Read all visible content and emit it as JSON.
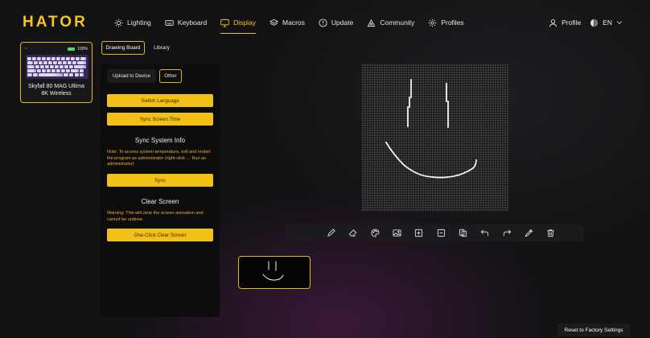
{
  "brand": "HATOR",
  "nav": {
    "items": [
      {
        "label": "Lighting",
        "icon": "sun-icon"
      },
      {
        "label": "Keyboard",
        "icon": "keyboard-icon"
      },
      {
        "label": "Display",
        "icon": "monitor-icon",
        "active": true
      },
      {
        "label": "Macros",
        "icon": "layers-icon"
      },
      {
        "label": "Update",
        "icon": "exclamation-circle-icon"
      },
      {
        "label": "Community",
        "icon": "community-icon"
      },
      {
        "label": "Profiles",
        "icon": "gear-icon"
      }
    ],
    "profile_label": "Profile",
    "language": "EN"
  },
  "device": {
    "name_line1": "Skyfall 80 MAG Ultima",
    "name_line2": "8K Wireless",
    "battery": "100%",
    "status_glyph": "~"
  },
  "subtabs": {
    "drawing_board": "Drawing Board",
    "library": "Library"
  },
  "panel": {
    "tab_upload": "Upload to Device",
    "tab_other": "Other",
    "switch_language": "Switch Language",
    "sync_screen_time": "Sync Screen Time",
    "sync_system_info_title": "Sync System Info",
    "sync_note": "Note: To access system temperature, exit and restart the program as administrator (right-click → Run as administrator)",
    "sync_button": "Sync",
    "clear_screen_title": "Clear Screen",
    "clear_warning": "Warning: This will clear the screen animation and cannot be undone.",
    "clear_button": "One-Click Clear Screen"
  },
  "toolbar": {
    "tools": [
      "pencil-icon",
      "eraser-icon",
      "palette-icon",
      "image-icon",
      "zoom-in-icon",
      "zoom-out-icon",
      "copy-icon",
      "undo-icon",
      "redo-icon",
      "eyedropper-icon",
      "trash-icon"
    ]
  },
  "footer": {
    "reset": "Reset to Factory Settings"
  },
  "colors": {
    "accent": "#f5c518",
    "warning_text": "#f2a93b",
    "background": "#121214"
  }
}
